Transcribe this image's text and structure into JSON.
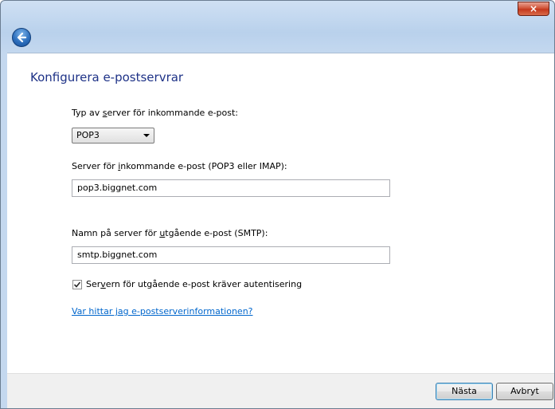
{
  "window": {
    "close_glyph": "×"
  },
  "page": {
    "title": "Konfigurera e-postservrar"
  },
  "incoming_type": {
    "label_pre": "Typ av ",
    "label_accel": "s",
    "label_post": "erver för inkommande e-post:",
    "selected": "POP3"
  },
  "incoming_server": {
    "label_pre": "Server för ",
    "label_accel": "i",
    "label_post": "nkommande e-post (POP3 eller IMAP):",
    "value": "pop3.biggnet.com"
  },
  "outgoing_server": {
    "label_pre": "Namn på server för ",
    "label_accel": "u",
    "label_post": "tgående e-post (SMTP):",
    "value": "smtp.biggnet.com"
  },
  "auth": {
    "checked": true,
    "label_pre": "Ser",
    "label_accel": "v",
    "label_post": "ern för utgående e-post kräver autentisering"
  },
  "help_link": "Var hittar jag e-postserverinformationen?",
  "footer": {
    "next_label": "Nästa",
    "cancel_label": "Avbryt"
  }
}
